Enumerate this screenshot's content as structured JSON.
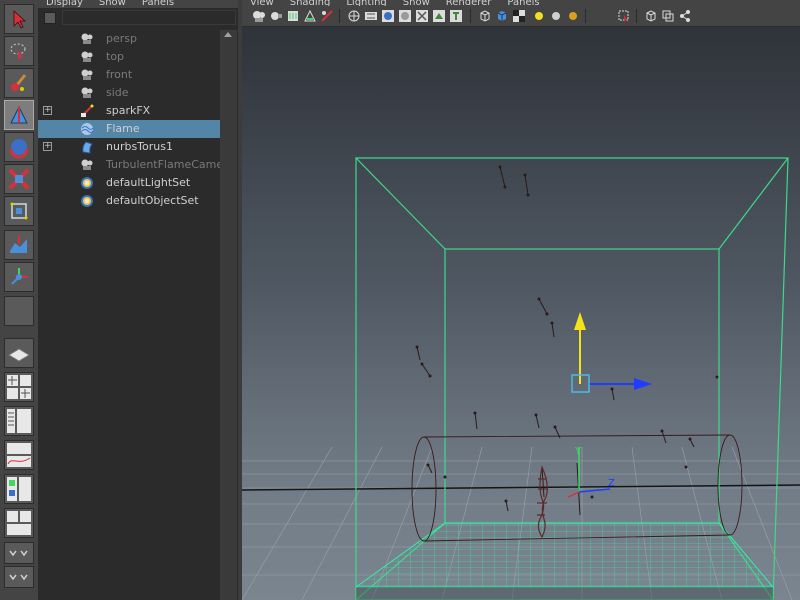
{
  "outliner": {
    "menu": [
      "Display",
      "Show",
      "Panels"
    ],
    "search": {
      "value": ""
    },
    "items": [
      {
        "label": "persp",
        "icon": "camera-icon",
        "dim": true,
        "expandable": false,
        "selected": false
      },
      {
        "label": "top",
        "icon": "camera-icon",
        "dim": true,
        "expandable": false,
        "selected": false
      },
      {
        "label": "front",
        "icon": "camera-icon",
        "dim": true,
        "expandable": false,
        "selected": false
      },
      {
        "label": "side",
        "icon": "camera-icon",
        "dim": true,
        "expandable": false,
        "selected": false
      },
      {
        "label": "sparkFX",
        "icon": "particle-icon",
        "dim": false,
        "expandable": true,
        "selected": false
      },
      {
        "label": "Flame",
        "icon": "fluid-icon",
        "dim": false,
        "expandable": false,
        "selected": true
      },
      {
        "label": "nurbsTorus1",
        "icon": "nurbs-surface-icon",
        "dim": false,
        "expandable": true,
        "selected": false
      },
      {
        "label": "TurbulentFlameCamera",
        "icon": "camera-icon",
        "dim": true,
        "expandable": false,
        "selected": false
      },
      {
        "label": "defaultLightSet",
        "icon": "set-icon",
        "dim": false,
        "expandable": false,
        "selected": false
      },
      {
        "label": "defaultObjectSet",
        "icon": "set-icon",
        "dim": false,
        "expandable": false,
        "selected": false
      }
    ]
  },
  "viewport": {
    "menu": [
      "View",
      "Shading",
      "Lighting",
      "Show",
      "Renderer",
      "Panels"
    ],
    "axis_labels": {
      "y": "Y",
      "z": "Z"
    }
  },
  "colors": {
    "selection": "#5285a6",
    "fluid_container": "#3fd98a",
    "emitter_grid": "#2ef0a8",
    "manipulator_x": "#1f3cff",
    "manipulator_y": "#f4e21a",
    "manipulator_center": "#4fb8e8"
  }
}
